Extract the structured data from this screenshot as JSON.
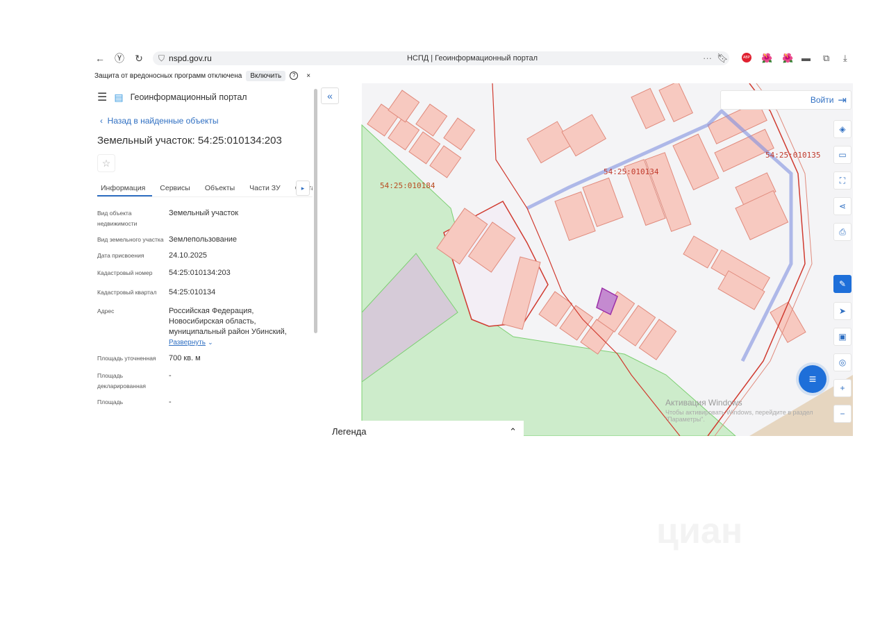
{
  "browser": {
    "url": "nspd.gov.ru",
    "page_title": "НСПД | Геоинформационный портал",
    "security_warning": "Защита от вредоносных программ отключена",
    "enable_button": "Включить",
    "help": "?",
    "close": "×",
    "extensions": [
      "ABP",
      "🌺",
      "🌺",
      "▬",
      "⧉",
      "⤓"
    ],
    "more": "···"
  },
  "app": {
    "title": "Геоинформационный портал",
    "back_link": "Назад в найденные объекты",
    "object_title": "Земельный участок: 54:25:010134:203",
    "tabs": [
      {
        "label": "Информация"
      },
      {
        "label": "Сервисы"
      },
      {
        "label": "Объекты"
      },
      {
        "label": "Части ЗУ"
      },
      {
        "label": "Соста"
      }
    ],
    "fields": [
      {
        "label": "Вид объекта недвижимости",
        "value": "Земельный участок"
      },
      {
        "label": "Вид земельного участка",
        "value": "Землепользование"
      },
      {
        "label": "Дата присвоения",
        "value": "24.10.2025"
      },
      {
        "label": "Кадастровый номер",
        "value": "54:25:010134:203"
      },
      {
        "label": "Кадастровый квартал",
        "value": "54:25:010134"
      },
      {
        "label": "Адрес",
        "value": "Российская Федерация, Новосибирская область, муниципальный район Убинский,"
      },
      {
        "label": "Площадь уточненная",
        "value": "700 кв. м"
      },
      {
        "label": "Площадь декларированная",
        "value": "-"
      },
      {
        "label": "Площадь",
        "value": "-"
      }
    ],
    "expand_link": "Развернуть"
  },
  "map": {
    "login": "Войти",
    "legend": "Легенда",
    "quarters": [
      "54:25:010184",
      "54:25:010134",
      "54:25:010135"
    ],
    "watermark_title": "Активация Windows",
    "watermark_text": "Чтобы активировать Windows, перейдите в раздел \"Параметры\".",
    "colors": {
      "parcel_fill": "#f7c9c0",
      "parcel_stroke": "#e08a7c",
      "quarter_border": "#d03a2f",
      "green": "#cdeccb",
      "selected": "#9b2fa8",
      "network": "#7f8fe0",
      "accent": "#2f6fc2"
    }
  },
  "watermark": "циан"
}
